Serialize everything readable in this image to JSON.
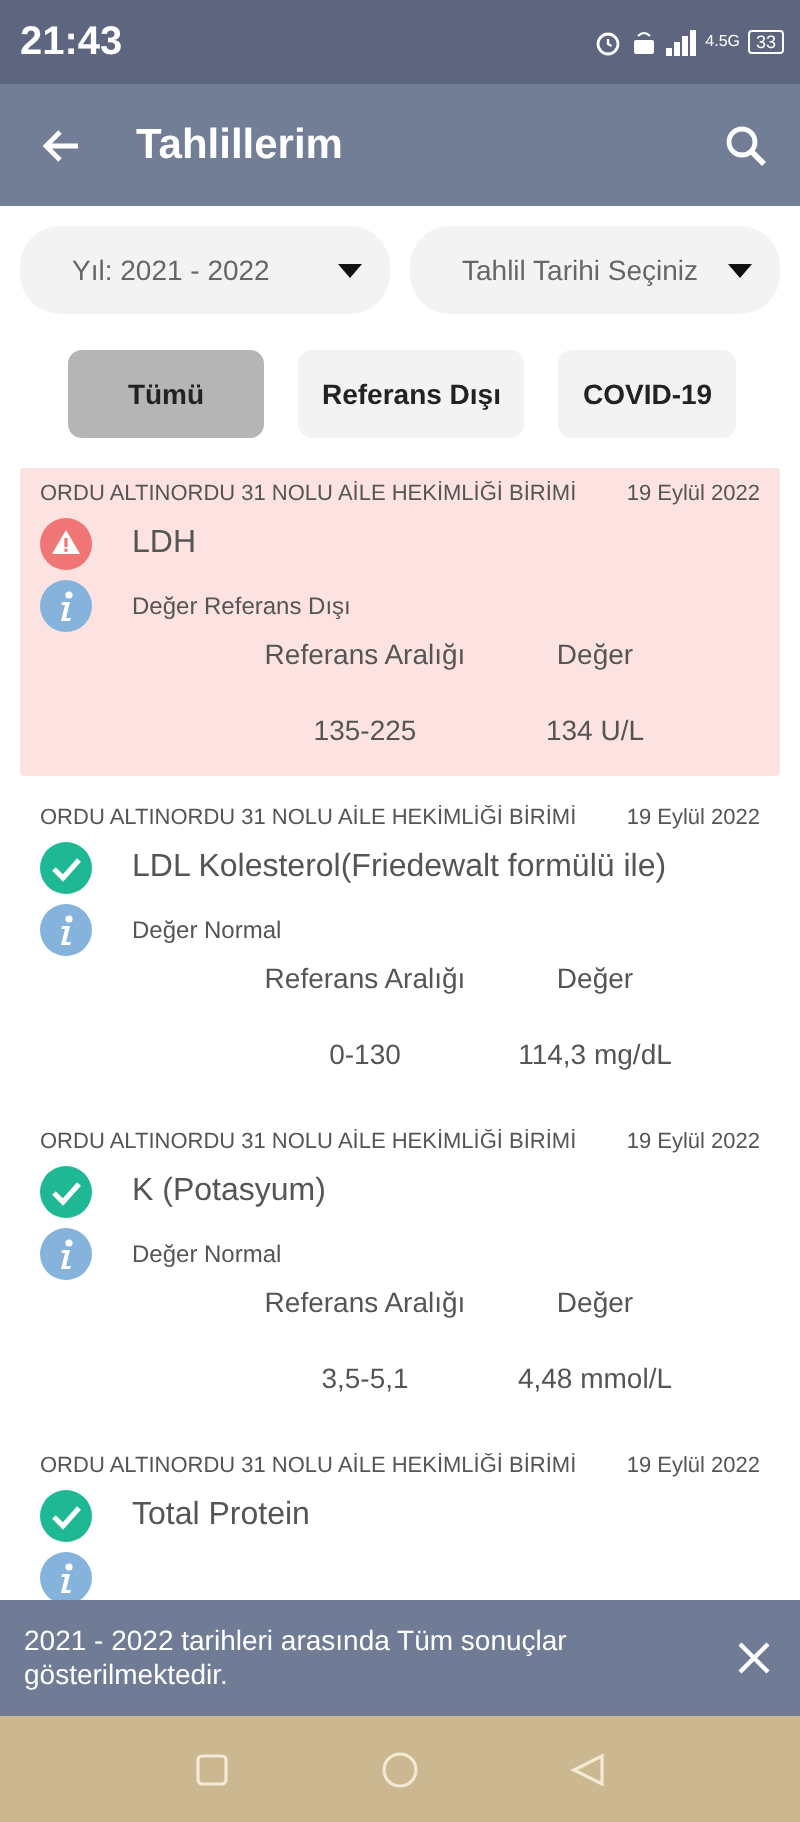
{
  "status_bar": {
    "time": "21:43",
    "network": "4.5G",
    "battery": "33"
  },
  "app_bar": {
    "title": "Tahlillerim"
  },
  "filters": [
    {
      "label": "Yıl: 2021 - 2022"
    },
    {
      "label": "Tahlil Tarihi Seçiniz"
    }
  ],
  "tabs": [
    {
      "label": "Tümü",
      "selected": true
    },
    {
      "label": "Referans Dışı",
      "selected": false
    },
    {
      "label": "COVID-19",
      "selected": false
    }
  ],
  "results": [
    {
      "kind": "warning",
      "institution": "ORDU ALTINORDU 31 NOLU AİLE HEKİMLİĞİ BİRİMİ",
      "date": "19 Eylül 2022",
      "test": "LDH",
      "status": "Değer Referans Dışı",
      "range_label": "Referans Aralığı",
      "value_label": "Değer",
      "range": "135-225",
      "value": "134 U/L"
    },
    {
      "kind": "normal",
      "institution": "ORDU ALTINORDU 31 NOLU AİLE HEKİMLİĞİ BİRİMİ",
      "date": "19 Eylül 2022",
      "test": "LDL Kolesterol(Friedewalt formülü ile)",
      "status": "Değer Normal",
      "range_label": "Referans Aralığı",
      "value_label": "Değer",
      "range": "0-130",
      "value": "114,3 mg/dL"
    },
    {
      "kind": "normal",
      "institution": "ORDU ALTINORDU 31 NOLU AİLE HEKİMLİĞİ BİRİMİ",
      "date": "19 Eylül 2022",
      "test": "K (Potasyum)",
      "status": "Değer Normal",
      "range_label": "Referans Aralığı",
      "value_label": "Değer",
      "range": "3,5-5,1",
      "value": "4,48 mmol/L"
    },
    {
      "kind": "normal",
      "institution": "ORDU ALTINORDU 31 NOLU AİLE HEKİMLİĞİ BİRİMİ",
      "date": "19 Eylül 2022",
      "test": "Total Protein"
    }
  ],
  "snackbar": {
    "message": "2021 - 2022 tarihleri arasında Tüm sonuçlar gösterilmektedir."
  }
}
